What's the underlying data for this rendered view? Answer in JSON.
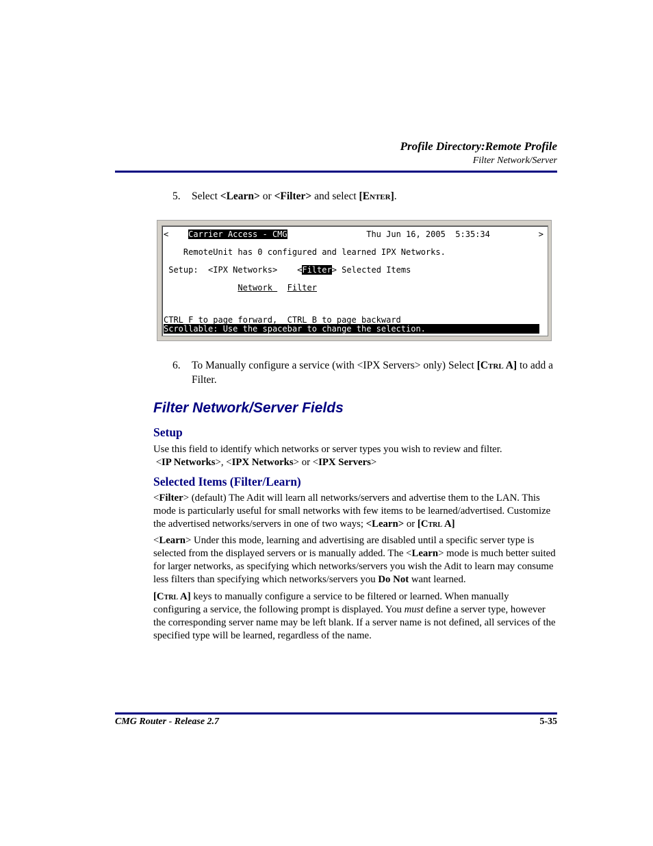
{
  "header": {
    "chapter_title": "Profile Directory:Remote Profile",
    "section_title": "Filter Network/Server"
  },
  "steps": [
    {
      "number": "5.",
      "parts": [
        "Select ",
        "<Learn>",
        " or ",
        "<Filter>",
        " and select ",
        "[Enter]",
        "."
      ]
    },
    {
      "number": "6.",
      "parts": [
        "To Manually configure a service (with <IPX Servers> only)  Select ",
        "[Ctrl A]",
        " to add a Filter."
      ]
    }
  ],
  "terminal": {
    "nav_left": "<",
    "nav_right": ">",
    "app_title": "Carrier Access - CMG",
    "datetime": "Thu Jun 16, 2005  5:35:34",
    "status_line": "RemoteUnit has 0 configured and learned IPX Networks.",
    "setup_label": "Setup:",
    "setup_value": "<IPX Networks>",
    "mode_open": "<",
    "mode_value": "Filter",
    "mode_close": ">",
    "mode_label": "Selected Items",
    "col_network": "Network ",
    "col_filter": "Filter",
    "help_line": "CTRL F to page forward,  CTRL B to page backward",
    "scroll_hint": "Scrollable: Use the spacebar to change the selection."
  },
  "fields_section": {
    "title": "Filter Network/Server Fields",
    "setup": {
      "heading": "Setup",
      "text": "Use this field to identify which networks or server types you wish to review and filter.",
      "opt_ip": "IP Networks",
      "opt_ipx": "IPX Networks",
      "opt_srv": "IPX Servers"
    },
    "selected_items": {
      "heading": "Selected Items (Filter/Learn)",
      "filter_key": "Filter",
      "filter_text": "  (default) The Adit will learn all networks/servers and advertise them to the LAN. This mode is particularly useful for small networks with few items to be learned/advertised. Customize the advertised networks/servers in one of two ways; ",
      "filter_learn": "<Learn>",
      "filter_or": " or ",
      "filter_ctrl": "[Ctrl A]",
      "learn_key": "Learn",
      "learn_text_1": " Under this mode, learning and advertising are disabled until a specific server type is selected from the displayed servers or is manually added. The <",
      "learn_key_2": "Learn",
      "learn_text_2": "> mode is much better suited for larger networks, as specifying which networks/servers you wish the Adit to learn may consume less filters than specifying which networks/servers you ",
      "learn_donot": "Do Not",
      "learn_text_3": " want learned.",
      "ctrla_key": "[Ctrl A]",
      "ctrla_text_1": " keys to manually configure a service to be filtered or learned. When manually configuring a service, the following prompt is displayed. You ",
      "ctrla_must": "must",
      "ctrla_text_2": " define a server type, however the corresponding server name may be left blank. If a server name is not defined, all services of the specified type will be learned, regardless of the name."
    }
  },
  "footer": {
    "product": "CMG Router - Release 2.7",
    "page_number": "5-35"
  }
}
